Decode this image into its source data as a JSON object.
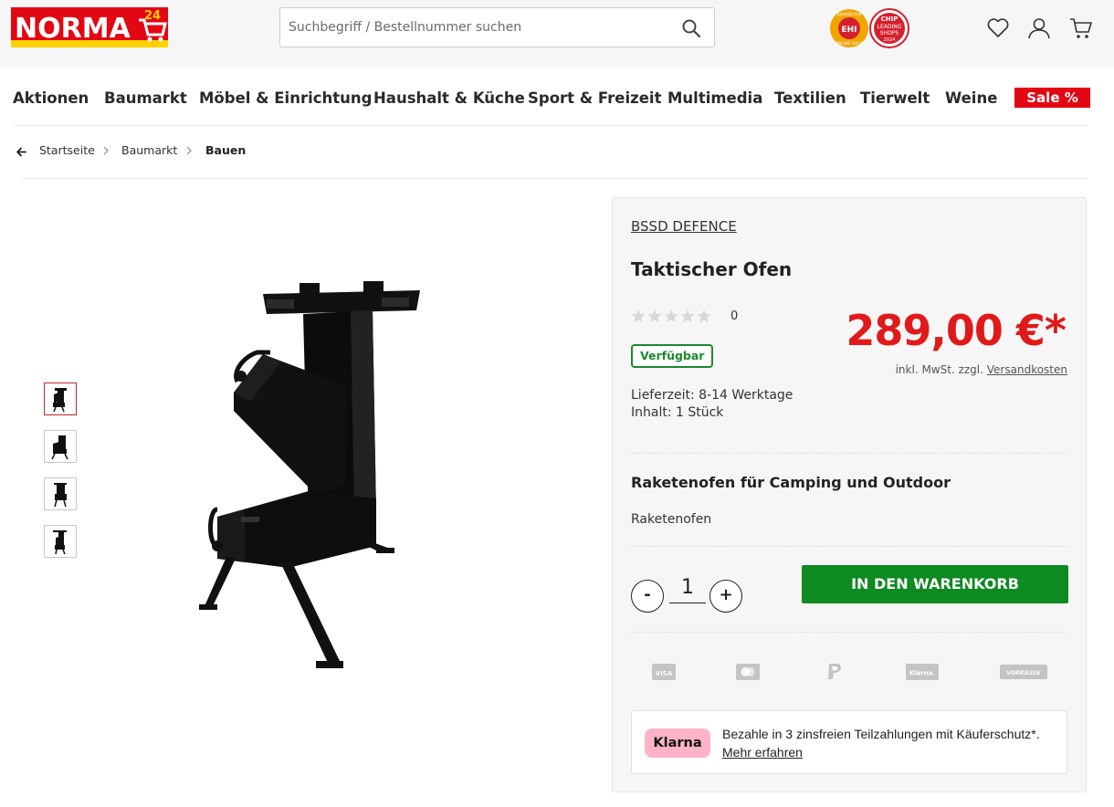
{
  "header": {
    "logo_text": "NORMA",
    "logo_badge": "24",
    "search_placeholder": "Suchbegriff / Bestellnummer suchen",
    "trust_badges": [
      {
        "name": "ehi-badge",
        "lines": [
          "GEPRÜFTER",
          "EHI",
          "ONLINE-SHOP"
        ]
      },
      {
        "name": "chip-badge",
        "lines": [
          "CHIP",
          "LEADING",
          "SHOPS",
          "2024"
        ]
      }
    ],
    "icons": [
      "search-icon",
      "heart-icon",
      "user-icon",
      "cart-icon"
    ]
  },
  "nav": {
    "items": [
      "Aktionen",
      "Baumarkt",
      "Möbel & Einrichtung",
      "Haushalt & Küche",
      "Sport & Freizeit",
      "Multimedia",
      "Textilien",
      "Tierwelt",
      "Weine"
    ],
    "sale": "Sale %"
  },
  "breadcrumb": {
    "items": [
      "Startseite",
      "Baumarkt",
      "Bauen"
    ]
  },
  "product": {
    "brand": "BSSD DEFENCE",
    "title": "Taktischer Ofen",
    "rating_stars": 0,
    "rating_count": "0",
    "price": "289,00 €*",
    "tax_prefix": "inkl. MwSt. zzgl.",
    "tax_link": "Versandkosten",
    "availability": "Verfügbar",
    "delivery": "Lieferzeit: 8-14 Werktage",
    "content": "Inhalt: 1 Stück",
    "subtitle": "Raketenofen für Camping und Outdoor",
    "description": "Raketenofen",
    "quantity": "1",
    "minus": "-",
    "plus": "+",
    "cart_button": "IN DEN WARENKORB",
    "payment_methods": [
      "VISA",
      "Mastercard",
      "PayPal",
      "Klarna.",
      "VORKASSE"
    ],
    "klarna": {
      "logo": "Klarna",
      "text": "Bezahle in 3 zinsfreien Teilzahlungen mit Käuferschutz*.",
      "link": "Mehr erfahren"
    }
  },
  "gallery": {
    "thumbnail_count": 4,
    "active_index": 0
  },
  "colors": {
    "brand_red": "#e30613",
    "price_red": "#e01a1a",
    "cart_green": "#0d8a20",
    "klarna_pink": "#ffb3c7"
  }
}
